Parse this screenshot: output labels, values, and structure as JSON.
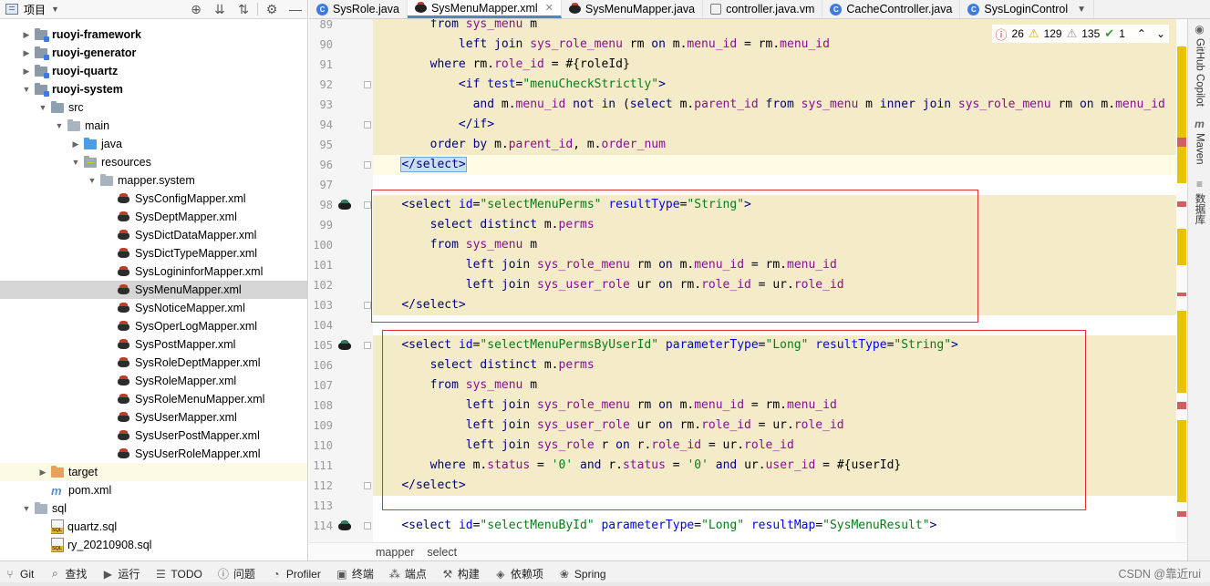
{
  "project_panel": {
    "title": "项目",
    "tree": [
      {
        "label": "ruoyi-framework",
        "indent": 0,
        "arrow": "▶",
        "icon": "module",
        "bold": true
      },
      {
        "label": "ruoyi-generator",
        "indent": 0,
        "arrow": "▶",
        "icon": "module",
        "bold": true
      },
      {
        "label": "ruoyi-quartz",
        "indent": 0,
        "arrow": "▶",
        "icon": "module",
        "bold": true
      },
      {
        "label": "ruoyi-system",
        "indent": 0,
        "arrow": "▼",
        "icon": "module",
        "bold": true
      },
      {
        "label": "src",
        "indent": 1,
        "arrow": "▼",
        "icon": "src"
      },
      {
        "label": "main",
        "indent": 2,
        "arrow": "▼",
        "icon": "plain"
      },
      {
        "label": "java",
        "indent": 3,
        "arrow": "▶",
        "icon": "java"
      },
      {
        "label": "resources",
        "indent": 3,
        "arrow": "▼",
        "icon": "res"
      },
      {
        "label": "mapper.system",
        "indent": 4,
        "arrow": "▼",
        "icon": "plain"
      },
      {
        "label": "SysConfigMapper.xml",
        "indent": 5,
        "icon": "mybatis"
      },
      {
        "label": "SysDeptMapper.xml",
        "indent": 5,
        "icon": "mybatis"
      },
      {
        "label": "SysDictDataMapper.xml",
        "indent": 5,
        "icon": "mybatis"
      },
      {
        "label": "SysDictTypeMapper.xml",
        "indent": 5,
        "icon": "mybatis"
      },
      {
        "label": "SysLogininforMapper.xml",
        "indent": 5,
        "icon": "mybatis"
      },
      {
        "label": "SysMenuMapper.xml",
        "indent": 5,
        "icon": "mybatis",
        "selected": true
      },
      {
        "label": "SysNoticeMapper.xml",
        "indent": 5,
        "icon": "mybatis"
      },
      {
        "label": "SysOperLogMapper.xml",
        "indent": 5,
        "icon": "mybatis"
      },
      {
        "label": "SysPostMapper.xml",
        "indent": 5,
        "icon": "mybatis"
      },
      {
        "label": "SysRoleDeptMapper.xml",
        "indent": 5,
        "icon": "mybatis"
      },
      {
        "label": "SysRoleMapper.xml",
        "indent": 5,
        "icon": "mybatis"
      },
      {
        "label": "SysRoleMenuMapper.xml",
        "indent": 5,
        "icon": "mybatis"
      },
      {
        "label": "SysUserMapper.xml",
        "indent": 5,
        "icon": "mybatis"
      },
      {
        "label": "SysUserPostMapper.xml",
        "indent": 5,
        "icon": "mybatis"
      },
      {
        "label": "SysUserRoleMapper.xml",
        "indent": 5,
        "icon": "mybatis"
      },
      {
        "label": "target",
        "indent": 1,
        "arrow": "▶",
        "icon": "target",
        "excluded": true
      },
      {
        "label": "pom.xml",
        "indent": 1,
        "icon": "maven"
      },
      {
        "label": "sql",
        "indent": 0,
        "arrow": "▼",
        "icon": "plain"
      },
      {
        "label": "quartz.sql",
        "indent": 1,
        "icon": "sql"
      },
      {
        "label": "ry_20210908.sql",
        "indent": 1,
        "icon": "sql"
      }
    ]
  },
  "tabs": [
    {
      "label": "SysRole.java",
      "icon": "c"
    },
    {
      "label": "SysMenuMapper.xml",
      "icon": "mb",
      "active": true,
      "closable": true
    },
    {
      "label": "SysMenuMapper.java",
      "icon": "mb"
    },
    {
      "label": "controller.java.vm",
      "icon": "vm"
    },
    {
      "label": "CacheController.java",
      "icon": "c"
    },
    {
      "label": "SysLoginControl",
      "icon": "c",
      "menu": true
    }
  ],
  "inspections": {
    "errors": "26",
    "warnings": "129",
    "weak": "135",
    "ok": "1"
  },
  "code_lines": [
    {
      "n": "89",
      "hl": true,
      "parts": [
        [
          "        ",
          "tx"
        ],
        [
          "from ",
          "kw"
        ],
        [
          "sys_menu",
          "tb"
        ],
        [
          " m",
          "tx"
        ]
      ]
    },
    {
      "n": "90",
      "hl": true,
      "parts": [
        [
          "            ",
          "tx"
        ],
        [
          "left join ",
          "kw"
        ],
        [
          "sys_role_menu",
          "tb"
        ],
        [
          " rm ",
          "tx"
        ],
        [
          "on ",
          "kw"
        ],
        [
          "m.",
          "tx"
        ],
        [
          "menu_id",
          "fd"
        ],
        [
          " = rm.",
          "tx"
        ],
        [
          "menu_id",
          "fd"
        ]
      ]
    },
    {
      "n": "91",
      "hl": true,
      "parts": [
        [
          "        ",
          "tx"
        ],
        [
          "where ",
          "kw"
        ],
        [
          "rm.",
          "tx"
        ],
        [
          "role_id",
          "fd"
        ],
        [
          " = #{roleId}",
          "tx"
        ]
      ]
    },
    {
      "n": "92",
      "hl": true,
      "fold": true,
      "parts": [
        [
          "            ",
          "tx"
        ],
        [
          "<if ",
          "tg"
        ],
        [
          "test",
          "at"
        ],
        [
          "=",
          "tx"
        ],
        [
          "\"menuCheckStrictly\"",
          "av"
        ],
        [
          ">",
          "tg"
        ]
      ]
    },
    {
      "n": "93",
      "hl": true,
      "parts": [
        [
          "              ",
          "tx"
        ],
        [
          "and ",
          "kw"
        ],
        [
          "m.",
          "tx"
        ],
        [
          "menu_id",
          "fd"
        ],
        [
          " ",
          "tx"
        ],
        [
          "not in ",
          "kw"
        ],
        [
          "(",
          "tx"
        ],
        [
          "select ",
          "kw"
        ],
        [
          "m.",
          "tx"
        ],
        [
          "parent_id",
          "fd"
        ],
        [
          " ",
          "tx"
        ],
        [
          "from ",
          "kw"
        ],
        [
          "sys_menu",
          "tb"
        ],
        [
          " m ",
          "tx"
        ],
        [
          "inner join ",
          "kw"
        ],
        [
          "sys_role_menu",
          "tb"
        ],
        [
          " rm ",
          "tx"
        ],
        [
          "on ",
          "kw"
        ],
        [
          "m.",
          "tx"
        ],
        [
          "menu_id",
          "fd"
        ]
      ]
    },
    {
      "n": "94",
      "hl": true,
      "fold": true,
      "parts": [
        [
          "            ",
          "tx"
        ],
        [
          "</if>",
          "tg"
        ]
      ]
    },
    {
      "n": "95",
      "hl": true,
      "parts": [
        [
          "        ",
          "tx"
        ],
        [
          "order by ",
          "kw"
        ],
        [
          "m.",
          "tx"
        ],
        [
          "parent_id",
          "fd"
        ],
        [
          ", m.",
          "tx"
        ],
        [
          "order_num",
          "fd"
        ]
      ]
    },
    {
      "n": "96",
      "cur": true,
      "fold": true,
      "parts": [
        [
          "    ",
          "tx"
        ],
        [
          "</select>",
          "sel"
        ]
      ]
    },
    {
      "n": "97",
      "parts": [
        [
          "",
          "tx"
        ]
      ]
    },
    {
      "n": "98",
      "hl": true,
      "icon": true,
      "fold": true,
      "parts": [
        [
          "    ",
          "tx"
        ],
        [
          "<select ",
          "tg"
        ],
        [
          "id",
          "at"
        ],
        [
          "=",
          "tx"
        ],
        [
          "\"selectMenuPerms\"",
          "av"
        ],
        [
          " ",
          "tx"
        ],
        [
          "resultType",
          "at"
        ],
        [
          "=",
          "tx"
        ],
        [
          "\"String\"",
          "av"
        ],
        [
          ">",
          "tg"
        ]
      ]
    },
    {
      "n": "99",
      "hl": true,
      "parts": [
        [
          "        ",
          "tx"
        ],
        [
          "select distinct ",
          "kw"
        ],
        [
          "m.",
          "tx"
        ],
        [
          "perms",
          "fd"
        ]
      ]
    },
    {
      "n": "100",
      "hl": true,
      "parts": [
        [
          "        ",
          "tx"
        ],
        [
          "from ",
          "kw"
        ],
        [
          "sys_menu",
          "tb"
        ],
        [
          " m",
          "tx"
        ]
      ]
    },
    {
      "n": "101",
      "hl": true,
      "parts": [
        [
          "             ",
          "tx"
        ],
        [
          "left join ",
          "kw"
        ],
        [
          "sys_role_menu",
          "tb"
        ],
        [
          " rm ",
          "tx"
        ],
        [
          "on ",
          "kw"
        ],
        [
          "m.",
          "tx"
        ],
        [
          "menu_id",
          "fd"
        ],
        [
          " = rm.",
          "tx"
        ],
        [
          "menu_id",
          "fd"
        ]
      ]
    },
    {
      "n": "102",
      "hl": true,
      "parts": [
        [
          "             ",
          "tx"
        ],
        [
          "left join ",
          "kw"
        ],
        [
          "sys_user_role",
          "tb"
        ],
        [
          " ur ",
          "tx"
        ],
        [
          "on ",
          "kw"
        ],
        [
          "rm.",
          "tx"
        ],
        [
          "role_id",
          "fd"
        ],
        [
          " = ur.",
          "tx"
        ],
        [
          "role_id",
          "fd"
        ]
      ]
    },
    {
      "n": "103",
      "hl": true,
      "fold": true,
      "parts": [
        [
          "    ",
          "tx"
        ],
        [
          "</select>",
          "tg"
        ]
      ]
    },
    {
      "n": "104",
      "parts": [
        [
          "",
          "tx"
        ]
      ]
    },
    {
      "n": "105",
      "hl": true,
      "icon": true,
      "fold": true,
      "parts": [
        [
          "    ",
          "tx"
        ],
        [
          "<select ",
          "tg"
        ],
        [
          "id",
          "at"
        ],
        [
          "=",
          "tx"
        ],
        [
          "\"selectMenuPermsByUserId\"",
          "av"
        ],
        [
          " ",
          "tx"
        ],
        [
          "parameterType",
          "at"
        ],
        [
          "=",
          "tx"
        ],
        [
          "\"Long\"",
          "av"
        ],
        [
          " ",
          "tx"
        ],
        [
          "resultType",
          "at"
        ],
        [
          "=",
          "tx"
        ],
        [
          "\"String\"",
          "av"
        ],
        [
          ">",
          "tg"
        ]
      ]
    },
    {
      "n": "106",
      "hl": true,
      "parts": [
        [
          "        ",
          "tx"
        ],
        [
          "select distinct ",
          "kw"
        ],
        [
          "m.",
          "tx"
        ],
        [
          "perms",
          "fd"
        ]
      ]
    },
    {
      "n": "107",
      "hl": true,
      "parts": [
        [
          "        ",
          "tx"
        ],
        [
          "from ",
          "kw"
        ],
        [
          "sys_menu",
          "tb"
        ],
        [
          " m",
          "tx"
        ]
      ]
    },
    {
      "n": "108",
      "hl": true,
      "parts": [
        [
          "             ",
          "tx"
        ],
        [
          "left join ",
          "kw"
        ],
        [
          "sys_role_menu",
          "tb"
        ],
        [
          " rm ",
          "tx"
        ],
        [
          "on ",
          "kw"
        ],
        [
          "m.",
          "tx"
        ],
        [
          "menu_id",
          "fd"
        ],
        [
          " = rm.",
          "tx"
        ],
        [
          "menu_id",
          "fd"
        ]
      ]
    },
    {
      "n": "109",
      "hl": true,
      "parts": [
        [
          "             ",
          "tx"
        ],
        [
          "left join ",
          "kw"
        ],
        [
          "sys_user_role",
          "tb"
        ],
        [
          " ur ",
          "tx"
        ],
        [
          "on ",
          "kw"
        ],
        [
          "rm.",
          "tx"
        ],
        [
          "role_id",
          "fd"
        ],
        [
          " = ur.",
          "tx"
        ],
        [
          "role_id",
          "fd"
        ]
      ]
    },
    {
      "n": "110",
      "hl": true,
      "parts": [
        [
          "             ",
          "tx"
        ],
        [
          "left join ",
          "kw"
        ],
        [
          "sys_role",
          "tb"
        ],
        [
          " r ",
          "tx"
        ],
        [
          "on ",
          "kw"
        ],
        [
          "r.",
          "tx"
        ],
        [
          "role_id",
          "fd"
        ],
        [
          " = ur.",
          "tx"
        ],
        [
          "role_id",
          "fd"
        ]
      ]
    },
    {
      "n": "111",
      "hl": true,
      "parts": [
        [
          "        ",
          "tx"
        ],
        [
          "where ",
          "kw"
        ],
        [
          "m.",
          "tx"
        ],
        [
          "status",
          "fd"
        ],
        [
          " = ",
          "tx"
        ],
        [
          "'0'",
          "av"
        ],
        [
          " ",
          "tx"
        ],
        [
          "and ",
          "kw"
        ],
        [
          "r.",
          "tx"
        ],
        [
          "status",
          "fd"
        ],
        [
          " = ",
          "tx"
        ],
        [
          "'0'",
          "av"
        ],
        [
          " ",
          "tx"
        ],
        [
          "and ",
          "kw"
        ],
        [
          "ur.",
          "tx"
        ],
        [
          "user_id",
          "fd"
        ],
        [
          " = #{userId}",
          "tx"
        ]
      ]
    },
    {
      "n": "112",
      "hl": true,
      "fold": true,
      "parts": [
        [
          "    ",
          "tx"
        ],
        [
          "</select>",
          "tg"
        ]
      ]
    },
    {
      "n": "113",
      "parts": [
        [
          "",
          "tx"
        ]
      ]
    },
    {
      "n": "114",
      "icon": true,
      "fold": true,
      "parts": [
        [
          "    ",
          "tx"
        ],
        [
          "<select ",
          "tg"
        ],
        [
          "id",
          "at"
        ],
        [
          "=",
          "tx"
        ],
        [
          "\"selectMenuById\"",
          "av"
        ],
        [
          " ",
          "tx"
        ],
        [
          "parameterType",
          "at"
        ],
        [
          "=",
          "tx"
        ],
        [
          "\"Long\"",
          "av"
        ],
        [
          " ",
          "tx"
        ],
        [
          "resultMap",
          "at"
        ],
        [
          "=",
          "tx"
        ],
        [
          "\"SysMenuResult\"",
          "av"
        ],
        [
          ">",
          "tg"
        ]
      ]
    }
  ],
  "breadcrumb": [
    "mapper",
    "select"
  ],
  "right_strip": [
    {
      "label": "GitHub Copilot",
      "icon": "◉"
    },
    {
      "label": "Maven",
      "icon": "m"
    },
    {
      "label": "数据库",
      "icon": "≡"
    }
  ],
  "bottom_bar": [
    {
      "label": "Git",
      "icon": "⑂"
    },
    {
      "label": "查找",
      "icon": "⌕"
    },
    {
      "label": "运行",
      "icon": "▶"
    },
    {
      "label": "TODO",
      "icon": "☰"
    },
    {
      "label": "问题",
      "icon": "ⓘ"
    },
    {
      "label": "Profiler",
      "icon": "◔"
    },
    {
      "label": "终端",
      "icon": "▣"
    },
    {
      "label": "端点",
      "icon": "⁂"
    },
    {
      "label": "构建",
      "icon": "⚒"
    },
    {
      "label": "依赖项",
      "icon": "◈"
    },
    {
      "label": "Spring",
      "icon": "❀"
    }
  ],
  "watermark": "CSDN @靠近rui",
  "colors": {
    "selected_row": "#d5d5d5",
    "code_highlight": "#f4ebc9",
    "red_box": "#dd3333",
    "stripe_yellow": "#e8c400",
    "stripe_red": "#d06060"
  }
}
